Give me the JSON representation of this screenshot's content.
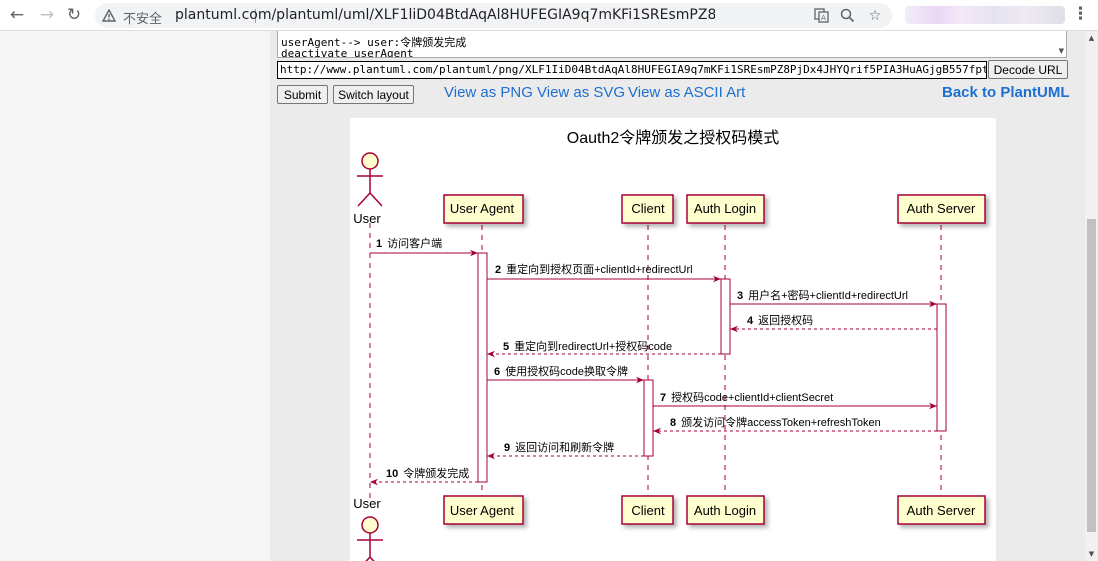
{
  "browser": {
    "security_label": "不安全",
    "url": "plantuml.com/plantuml/uml/XLF1liD04BtdAqAl8HUFEGIA9q7mKFi1SREsmPZ8PjDx4JHYQrif5PlA3HuAGjg..."
  },
  "source": {
    "line1": "userAgent--> user:令牌颁发完成",
    "line2": "deactivate userAgent"
  },
  "url_field": {
    "value": "http://www.plantuml.com/plantuml/png/XLF1IiD04BtdAqAl8HUFEGIA9q7mKFi1SREsmPZ8PjDx4JHYQrif5PIA3HuAGjgB557fptIJvYzCTk",
    "decode_label": "Decode URL"
  },
  "buttons": {
    "submit": "Submit",
    "switch_layout": "Switch layout"
  },
  "links": {
    "png": "View as PNG",
    "svg": "View as SVG",
    "ascii": "View as ASCII Art",
    "back": "Back to PlantUML"
  },
  "diagram": {
    "title": "Oauth2令牌颁发之授权码模式",
    "actor": "User",
    "participants": [
      "User Agent",
      "Client",
      "Auth Login",
      "Auth Server"
    ],
    "messages": [
      {
        "num": "1",
        "text": "访问客户端"
      },
      {
        "num": "2",
        "text": "重定向到授权页面+clientId+redirectUrl"
      },
      {
        "num": "3",
        "text": "用户名+密码+clientId+redirectUrl"
      },
      {
        "num": "4",
        "text": "返回授权码"
      },
      {
        "num": "5",
        "text": "重定向到redirectUrl+授权码code"
      },
      {
        "num": "6",
        "text": "使用授权码code换取令牌"
      },
      {
        "num": "7",
        "text": "授权码code+clientId+clientSecret"
      },
      {
        "num": "8",
        "text": "颁发访问令牌accessToken+refreshToken"
      },
      {
        "num": "9",
        "text": "返回访问和刷新令牌"
      },
      {
        "num": "10",
        "text": "令牌颁发完成"
      }
    ]
  },
  "colors": {
    "accent_link": "#1e6fd0",
    "participant_fill": "#fefece",
    "participant_border": "#a80036"
  }
}
